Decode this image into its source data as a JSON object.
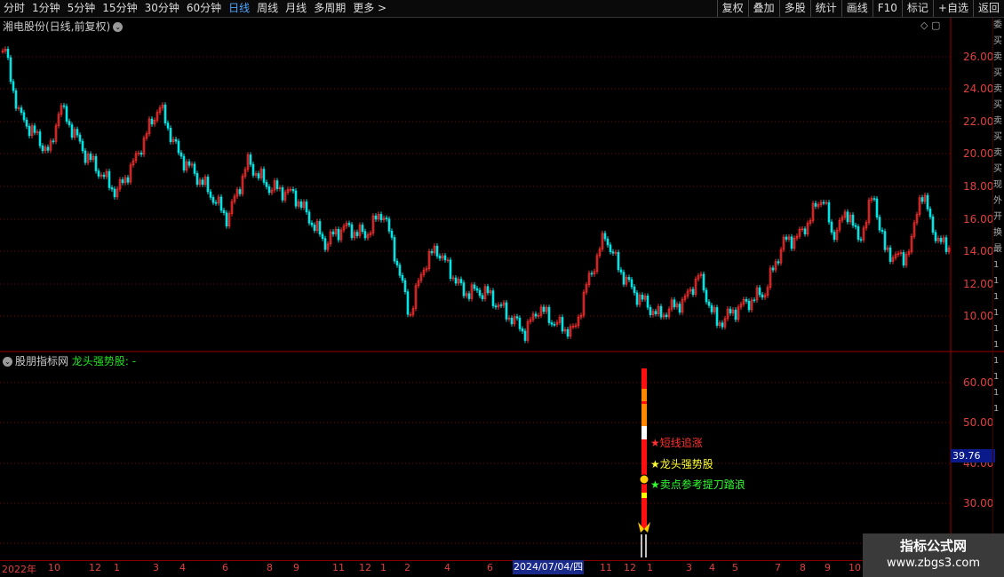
{
  "toolbar": {
    "periods": [
      "分时",
      "1分钟",
      "5分钟",
      "15分钟",
      "30分钟",
      "60分钟",
      "日线",
      "周线",
      "月线",
      "多周期",
      "更多 >"
    ],
    "active_period": "日线",
    "actions": [
      "复权",
      "叠加",
      "多股",
      "统计",
      "画线",
      "F10",
      "标记",
      "+自选",
      "返回"
    ]
  },
  "main_chart": {
    "title": "湘电股份(日线,前复权)",
    "y_ticks": [
      "26.00",
      "24.00",
      "22.00",
      "20.00",
      "18.00",
      "16.00",
      "14.00",
      "12.00",
      "10.00"
    ]
  },
  "sub_chart": {
    "name": "股朋指标网",
    "indicator": "龙头强势股: -",
    "y_ticks": [
      "60.00",
      "50.00",
      "40.00",
      "30.00"
    ],
    "price_tag": "39.76",
    "signals": [
      {
        "text": "★短线追涨",
        "color": "#ff3030"
      },
      {
        "text": "★龙头强势股",
        "color": "#ffff30"
      },
      {
        "text": "★卖点参考提刀踏浪",
        "color": "#30ff30"
      }
    ]
  },
  "date_axis": {
    "labels": [
      "2022年",
      "10",
      "12",
      "1",
      "3",
      "4",
      "6",
      "8",
      "9",
      "11",
      "12",
      "1",
      "2",
      "4",
      "6",
      "11",
      "12",
      "1",
      "3",
      "4",
      "5",
      "7",
      "8",
      "9",
      "10"
    ],
    "cursor_date": "2024/07/04/四"
  },
  "right_strip": [
    "委",
    "买",
    "卖",
    "买",
    "卖",
    "买",
    "卖",
    "买",
    "卖",
    "买",
    "现",
    "外",
    "开",
    "换",
    "最",
    "1",
    "1",
    "1",
    "1",
    "1",
    "1",
    "1",
    "1",
    "1",
    "1"
  ],
  "watermark": {
    "top": "指标公式网",
    "bottom": "www.zbgs3.com"
  },
  "colors": {
    "up": "#ff3030",
    "down": "#00e5e5",
    "grid": "#7a0000",
    "axis": "#e04040"
  }
}
